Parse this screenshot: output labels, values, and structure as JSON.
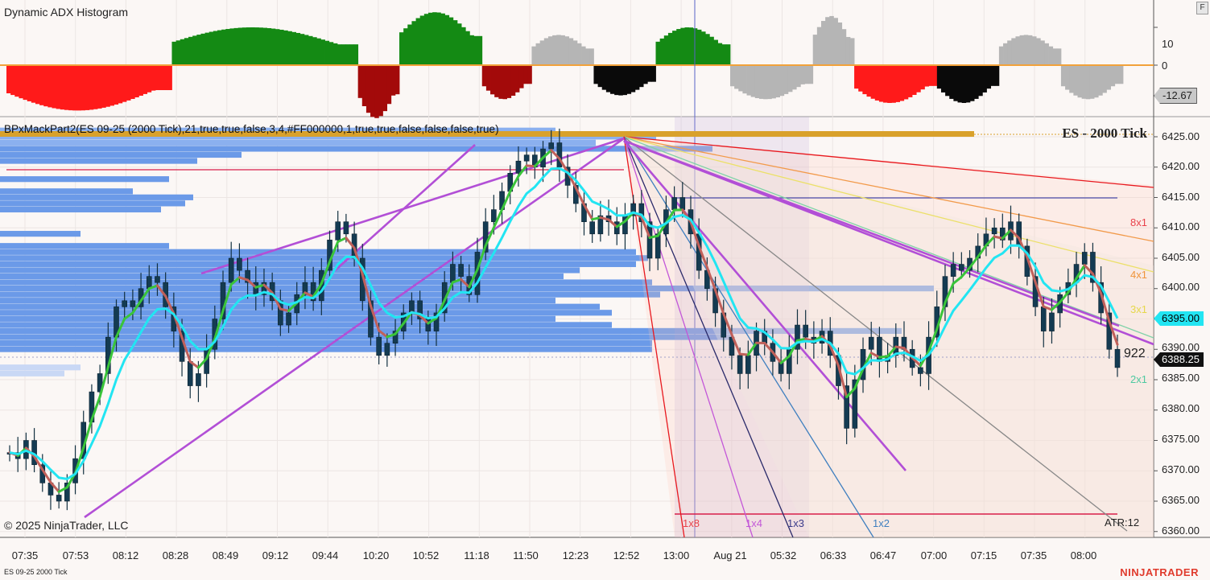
{
  "window": {
    "indicator_title": "Dynamic ADX Histogram",
    "price_title": "BPxMackPart2(ES 09-25 (2000 Tick),21,true,true,false,3,4,#FF000000,1,true,true,false,false,false,true)",
    "instrument_label": "ES - 2000 Tick",
    "copyright": "© 2025 NinjaTrader, LLC",
    "bottom_instrument": "ES 09-25 2000 Tick",
    "brand": "NINJATRADER",
    "float_button": "F"
  },
  "adx_axis": {
    "ticks": [
      "10",
      "0"
    ],
    "current_value_label": "-12.67"
  },
  "price_axis": {
    "ticks": [
      "6425.00",
      "6420.00",
      "6415.00",
      "6410.00",
      "6405.00",
      "6400.00",
      "6395.00",
      "6390.00",
      "6385.00",
      "6380.00",
      "6375.00",
      "6370.00",
      "6365.00",
      "6360.00"
    ],
    "tag_cyan": "6395.00",
    "tag_last": "6388.25",
    "bar_counter": "922",
    "atr_label": "ATR:12"
  },
  "time_axis": [
    "07:35",
    "07:53",
    "08:12",
    "08:28",
    "08:49",
    "09:12",
    "09:44",
    "10:20",
    "10:52",
    "11:18",
    "11:50",
    "12:23",
    "12:52",
    "13:00",
    "Aug 21",
    "05:32",
    "06:33",
    "06:47",
    "07:00",
    "07:15",
    "07:35",
    "08:00"
  ],
  "gann_fan_labels": {
    "right": [
      "8x1",
      "4x1",
      "3x1",
      "2x1"
    ],
    "bottom": [
      "1x8",
      "1x4",
      "1x3",
      "1x2"
    ]
  },
  "colors": {
    "ema_fast_cyan": "#22e5f2",
    "ema_slow_green": "#3ac43a",
    "trendline_purple": "#b24fd6",
    "volume_profile": "#6b9ae8",
    "tag_cyan": "#22e5f2",
    "tag_last": "#111111",
    "adx_negative_tag": "#c8c8c8",
    "brand": "#e03b2d"
  },
  "chart_data": [
    {
      "type": "bar",
      "name_label": "Dynamic ADX Histogram",
      "ylim": [
        -16,
        20
      ],
      "ticks": [
        10,
        0
      ],
      "last_value": -12.67,
      "segments": [
        {
          "value": -12,
          "bars": 40,
          "color": "red"
        },
        {
          "value": 10,
          "bars": 45,
          "color": "green"
        },
        {
          "value": -14,
          "bars": 10,
          "color": "darkred"
        },
        {
          "value": 14,
          "bars": 20,
          "color": "green"
        },
        {
          "value": -9,
          "bars": 12,
          "color": "darkred"
        },
        {
          "value": 8,
          "bars": 15,
          "color": "gray"
        },
        {
          "value": -8,
          "bars": 15,
          "color": "black"
        },
        {
          "value": 10,
          "bars": 18,
          "color": "green"
        },
        {
          "value": -9,
          "bars": 20,
          "color": "gray"
        },
        {
          "value": 13,
          "bars": 10,
          "color": "gray"
        },
        {
          "value": -10,
          "bars": 20,
          "color": "red"
        },
        {
          "value": -10,
          "bars": 15,
          "color": "black"
        },
        {
          "value": 8,
          "bars": 15,
          "color": "gray"
        },
        {
          "value": -9,
          "bars": 15,
          "color": "gray"
        }
      ]
    },
    {
      "type": "line",
      "title": "ES - 2000 Tick",
      "ylim": [
        6359,
        6428
      ],
      "close_series": [
        6373,
        6372,
        6375,
        6371,
        6368,
        6366,
        6365,
        6368,
        6372,
        6378,
        6383,
        6386,
        6392,
        6397,
        6398,
        6397,
        6400,
        6402,
        6401,
        6397,
        6393,
        6388,
        6384,
        6386,
        6390,
        6395,
        6401,
        6405,
        6403,
        6401,
        6399,
        6401,
        6398,
        6394,
        6396,
        6399,
        6401,
        6398,
        6403,
        6408,
        6411,
        6409,
        6405,
        6398,
        6392,
        6389,
        6391,
        6393,
        6396,
        6398,
        6395,
        6393,
        6396,
        6401,
        6404,
        6402,
        6399,
        6406,
        6411,
        6413,
        6416,
        6419,
        6421,
        6422,
        6420,
        6423,
        6424,
        6420,
        6417,
        6414,
        6411,
        6409,
        6412,
        6411,
        6409,
        6412,
        6414,
        6411,
        6405,
        6409,
        6413,
        6415,
        6413,
        6409,
        6403,
        6400,
        6396,
        6392,
        6389,
        6386,
        6389,
        6393,
        6391,
        6388,
        6386,
        6390,
        6394,
        6392,
        6391,
        6393,
        6389,
        6384,
        6377,
        6385,
        6390,
        6392,
        6388,
        6389,
        6392,
        6390,
        6387,
        6386,
        6392,
        6397,
        6402,
        6404,
        6403,
        6405,
        6407,
        6409,
        6410,
        6408,
        6411,
        6407,
        6402,
        6397,
        6393,
        6396,
        6399,
        6401,
        6404,
        6406,
        6401,
        6396,
        6390,
        6387
      ],
      "ema_fast": "cyan",
      "ema_slow": "green",
      "last_price": 6388.25,
      "cyan_level": 6395.0,
      "bar_counter": 922
    }
  ]
}
